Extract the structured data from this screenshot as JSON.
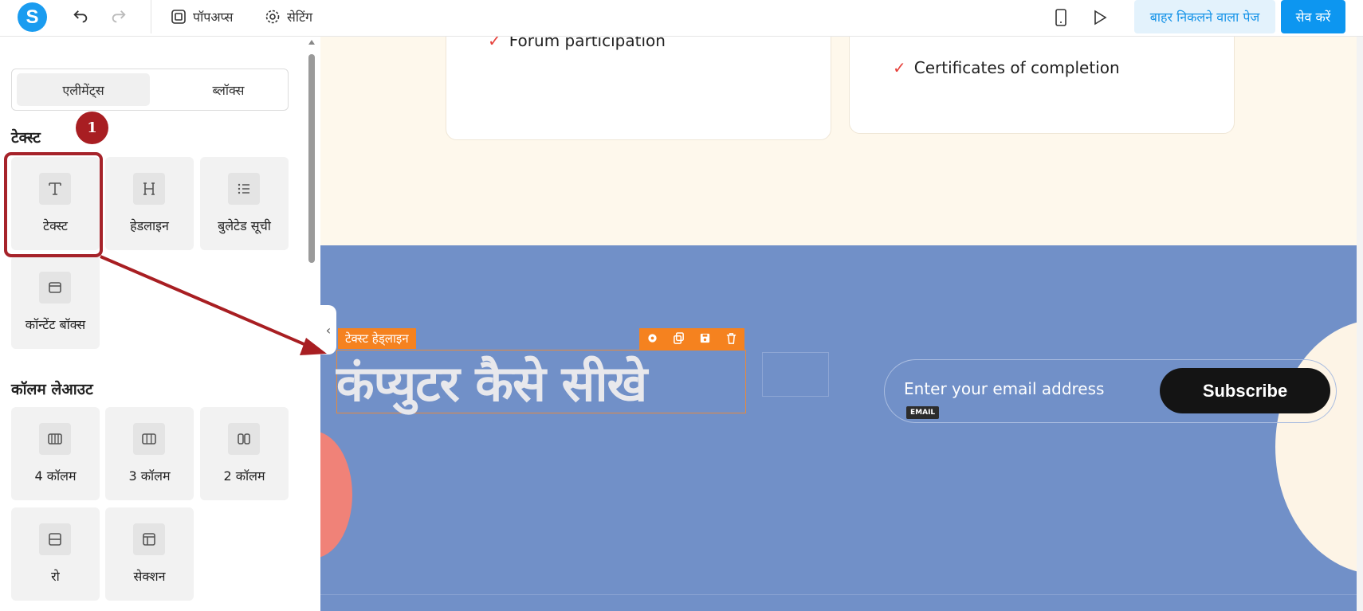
{
  "topbar": {
    "logo_letter": "S",
    "popups_label": "पॉपअप्स",
    "settings_label": "सेटिंग",
    "exit_page_label": "बाहर निकलने वाला पेज",
    "save_label": "सेव करें"
  },
  "sidebar": {
    "tabs": [
      {
        "label": "एलीमेंट्स",
        "active": true
      },
      {
        "label": "ब्लॉक्स",
        "active": false
      }
    ],
    "text_section": {
      "title": "टेक्स्ट",
      "items": [
        {
          "label": "टेक्स्ट",
          "icon": "text-icon"
        },
        {
          "label": "हेडलाइन",
          "icon": "headline-icon"
        },
        {
          "label": "बुलेटेड सूची",
          "icon": "list-icon"
        },
        {
          "label": "कॉन्टेंट बॉक्स",
          "icon": "content-box-icon"
        }
      ]
    },
    "column_section": {
      "title": "कॉलम लेआउट",
      "items": [
        {
          "label": "4 कॉलम",
          "icon": "four-column-icon"
        },
        {
          "label": "3 कॉलम",
          "icon": "three-column-icon"
        },
        {
          "label": "2 कॉलम",
          "icon": "two-column-icon"
        },
        {
          "label": "रो",
          "icon": "row-icon"
        },
        {
          "label": "सेक्शन",
          "icon": "section-icon"
        }
      ]
    }
  },
  "annotation": {
    "step_number": "1",
    "color": "#a81e22"
  },
  "canvas": {
    "card1_item": "Forum participation",
    "card2_item": "Certificates of completion",
    "selected_label": "टेक्स्ट हेड्लाइन",
    "headline": "कंप्युटर कैसे सीखे",
    "email_placeholder": "Enter your email address",
    "email_tag": "EMAIL",
    "subscribe_label": "Subscribe"
  },
  "colors": {
    "accent": "#0d96f0",
    "selection": "#f5821f",
    "section_blue": "#7190c8",
    "cream": "#fef8ec"
  }
}
